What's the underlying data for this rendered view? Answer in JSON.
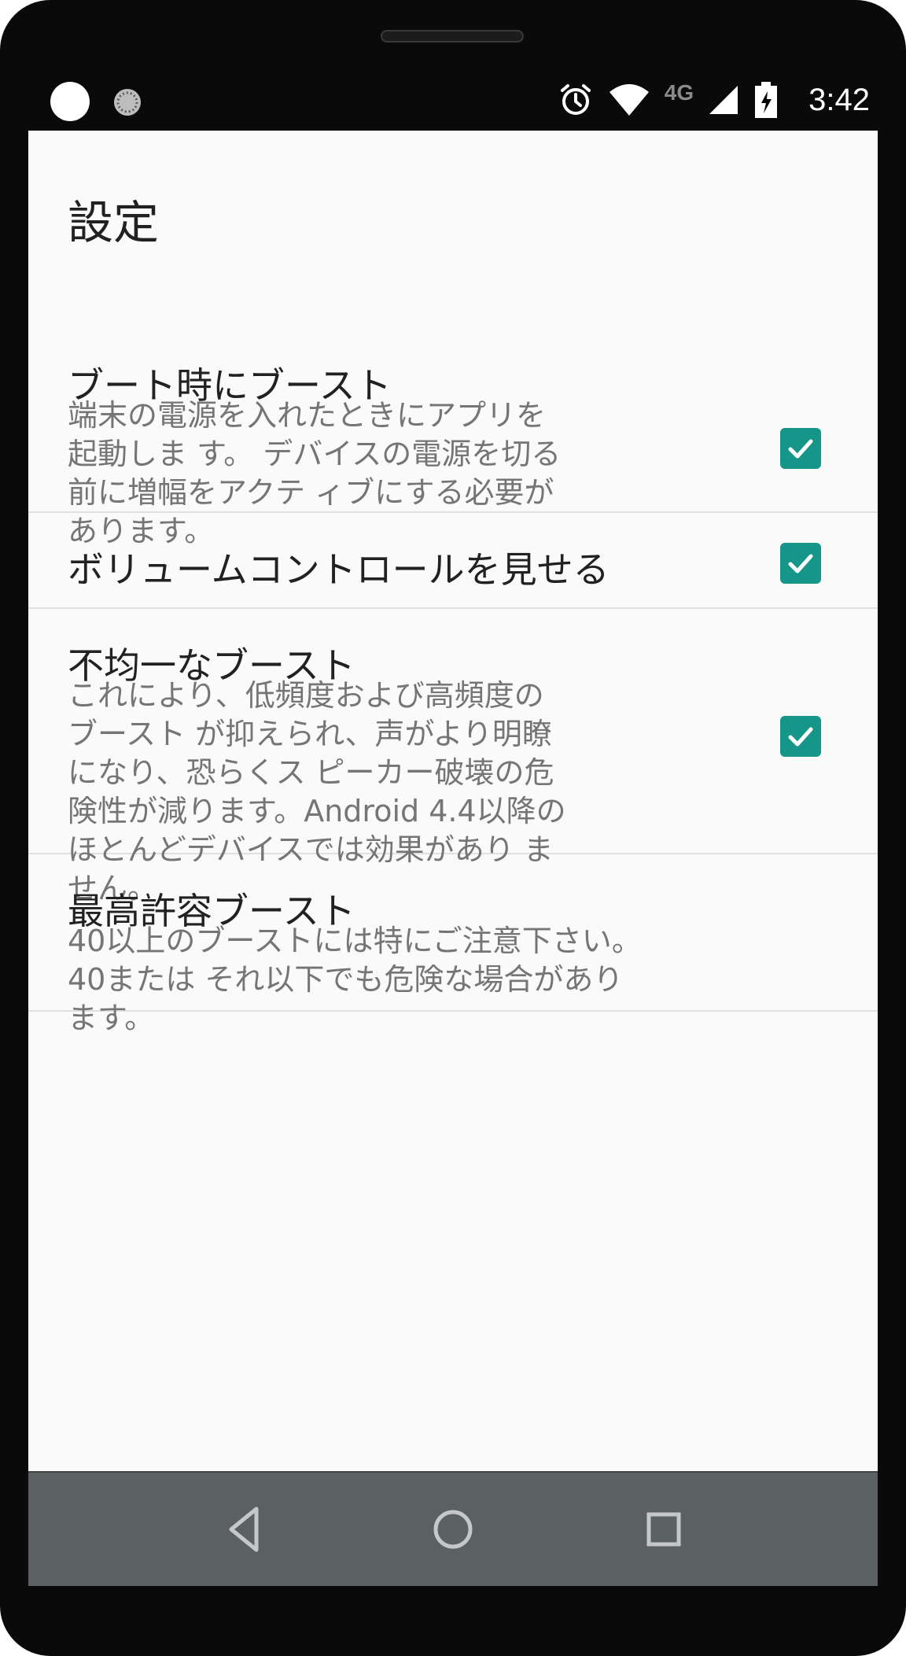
{
  "status_bar": {
    "network_label": "4G",
    "time": "3:42"
  },
  "settings": {
    "title": "設定",
    "items": [
      {
        "title": "ブート時にブースト",
        "summary": "端末の電源を入れたときにアプリを起動しま す。 デバイスの電源を切る前に増幅をアクテ ィブにする必要があります。",
        "checked": true
      },
      {
        "title": "ボリュームコントロールを見せる",
        "checked": true
      },
      {
        "title": "不均一なブースト",
        "summary": "これにより、低頻度および高頻度のブースト が抑えられ、声がより明瞭になり、恐らくス ピーカー破壊の危険性が減ります。Android 4.4以降のほとんどデバイスでは効果があり ません。",
        "checked": true
      },
      {
        "title": "最高許容ブースト",
        "summary": "40以上のブーストには特にご注意下さい。40または それ以下でも危険な場合があります。"
      }
    ]
  },
  "colors": {
    "accent": "#159688",
    "background": "#fafafa",
    "navbar": "#5b6063"
  },
  "icons": {
    "status_left": [
      "notification-dot-icon",
      "loading-spinner-icon"
    ],
    "status_right": [
      "alarm-icon",
      "wifi-icon",
      "cell-signal-icon",
      "battery-charging-icon"
    ],
    "nav": [
      "back-icon",
      "home-icon",
      "recents-icon"
    ]
  }
}
